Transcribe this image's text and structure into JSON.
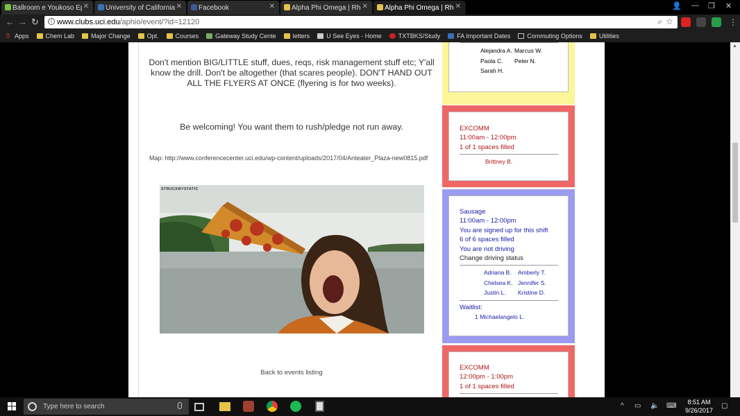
{
  "browser": {
    "tabs": [
      {
        "title": "Ballroom e Youkoso Epis",
        "favicon_color": "#7bc043"
      },
      {
        "title": "University of California, I",
        "favicon_color": "#3b6fb6"
      },
      {
        "title": "Facebook",
        "favicon_color": "#3b5998"
      },
      {
        "title": "Alpha Phi Omega | Rho P",
        "favicon_color": "#e5c34a"
      },
      {
        "title": "Alpha Phi Omega | Rho P",
        "favicon_color": "#e5c34a"
      }
    ],
    "url_host": "www.clubs.uci.edu",
    "url_path": "/aphio/event/?id=12120",
    "bookmarks": [
      "Apps",
      "Chem Lab",
      "Major Change",
      "Opt.",
      "Courses",
      "Gateway Study Cente",
      "letters",
      "U See Eyes - Home",
      "TXTBKS/Study",
      "FA Important Dates",
      "Commuting Options",
      "Utilities"
    ]
  },
  "page": {
    "paragraph_1": "Don't mention BIG/LITTLE stuff, dues, reqs, risk management stuff etc; Y'all know the drill. Don't be altogether (that scares people). DON'T HAND OUT ALL THE FLYERS AT ONCE (flyering is for two weeks).",
    "paragraph_2": "Be welcoming! You want them to rush/pledge not run away.",
    "map_line": "Map: http://www.conferencecenter.uci.edu/wp-content/uploads/2017/04/Anteater_Plaza-new0815.pdf",
    "gif_credit": "STRUCKBYSTATIC",
    "back_link": "Back to events listing"
  },
  "shifts": [
    {
      "names": [
        [
          "Alejandra A.",
          "Marcus W."
        ],
        [
          "Paola C.",
          "Peter N."
        ],
        [
          "Sarah H.",
          ""
        ]
      ]
    },
    {
      "title": "EXCOMM",
      "time": "11:00am - 12:00pm",
      "filled": "1 of 1 spaces filled",
      "solo_name": "Brittney B.",
      "color": "#ef6767",
      "text_color": "#b01818"
    },
    {
      "title": "Sausage",
      "time": "11:00am - 12:00pm",
      "signed_up": "You are signed up for this shift",
      "filled": "6 of 6 spaces filled",
      "driving": "You are not driving",
      "change_driving": "Change driving status",
      "names": [
        [
          "Adriana B.",
          "Amberly T."
        ],
        [
          "Chelsea K.",
          "Jennifer S."
        ],
        [
          "Justin L.",
          "Kristine D."
        ]
      ],
      "waitlist_label": "Waitlist:",
      "waitlist_entry": "1 Michaelangelo L.",
      "color": "#9b9bf2",
      "text_color": "#1b1ba8"
    },
    {
      "title": "EXCOMM",
      "time": "12:00pm - 1:00pm",
      "filled": "1 of 1 spaces filled",
      "color": "#ef6767",
      "text_color": "#b01818"
    }
  ],
  "taskbar": {
    "search_placeholder": "Type here to search",
    "time": "8:51 AM",
    "date": "9/26/2017"
  }
}
